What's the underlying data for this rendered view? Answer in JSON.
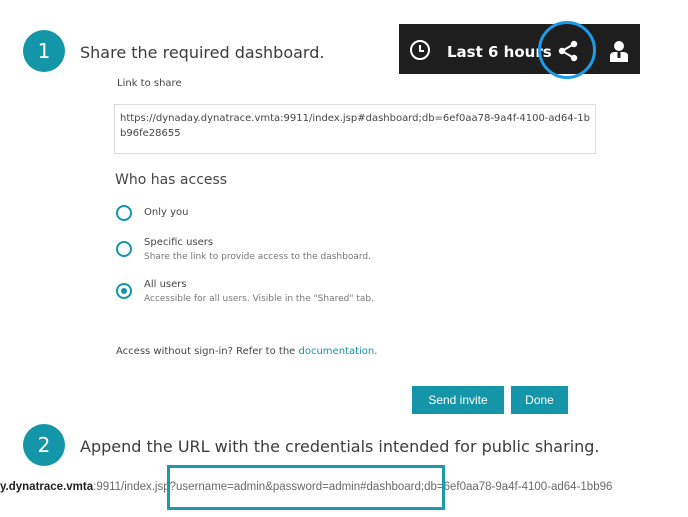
{
  "step1": {
    "number": "1",
    "text": "Share the required dashboard."
  },
  "toolbar": {
    "clock_icon": "clock-icon",
    "time_range": "Last 6 hours",
    "share_icon": "share-icon",
    "user_icon": "user-icon",
    "highlight_color": "#1e9be8"
  },
  "dialog": {
    "link_label": "Link to share",
    "link_value": "https://dynaday.dynatrace.vmta:9911/index.jsp#dashboard;db=6ef0aa78-9a4f-4100-ad64-1bb96fe28655",
    "access_heading": "Who has access",
    "options": [
      {
        "label": "Only you",
        "sub": "",
        "checked": false
      },
      {
        "label": "Specific users",
        "sub": "Share the link to provide access to the dashboard.",
        "checked": false
      },
      {
        "label": "All users",
        "sub": "Accessible for all users. Visible in the \"Shared\" tab.",
        "checked": true
      }
    ],
    "signin_text": "Access without sign-in? Refer to the ",
    "signin_link": "documentation",
    "signin_end": ".",
    "send_invite": "Send invite",
    "done": "Done",
    "accent": "#1496a8"
  },
  "step2": {
    "number": "2",
    "text": "Append the URL with the credentials intended for public sharing."
  },
  "url_example": {
    "host_bold": "y.dynatrace.vmta",
    "rest": ":9911/index.jsp?username=admin&password=admin#dashboard;db=6ef0aa78-9a4f-4100-ad64-1bb96"
  }
}
